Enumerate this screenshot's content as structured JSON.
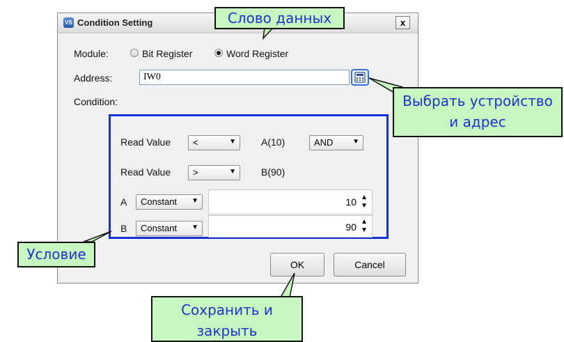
{
  "dialog": {
    "app_icon": "app-logo-icon",
    "app_icon_text": "VS",
    "title": "Condition Setting",
    "close_label": "x",
    "module_label": "Module:",
    "module_options": [
      "Bit Register",
      "Word Register"
    ],
    "module_selected": "Word Register",
    "address_label": "Address:",
    "address_value": "IW0",
    "address_button_icon": "device-picker-icon",
    "condition_label": "Condition:"
  },
  "condition": {
    "row1": {
      "label": "Read Value",
      "operator": "<",
      "operand": "A(10)",
      "logic": "AND"
    },
    "row2": {
      "label": "Read Value",
      "operator": ">",
      "operand": "B(90)"
    },
    "a": {
      "label": "A",
      "source": "Constant",
      "value": "10"
    },
    "b": {
      "label": "B",
      "source": "Constant",
      "value": "90"
    },
    "dropdown_icon": "chevron-down-icon",
    "spin_icons": [
      "spin-up-icon",
      "spin-down-icon"
    ]
  },
  "buttons": {
    "ok": "OK",
    "cancel": "Cancel"
  },
  "annotations": {
    "data_word": "Слово данных",
    "select_device": [
      "Выбрать устройство",
      "и адрес"
    ],
    "condition": "Условие",
    "save_close": [
      "Сохранить и",
      "закрыть"
    ],
    "fill_color": "#c9f5c0",
    "text_color": "#1c36c8",
    "highlight_color": "#1530d8"
  }
}
